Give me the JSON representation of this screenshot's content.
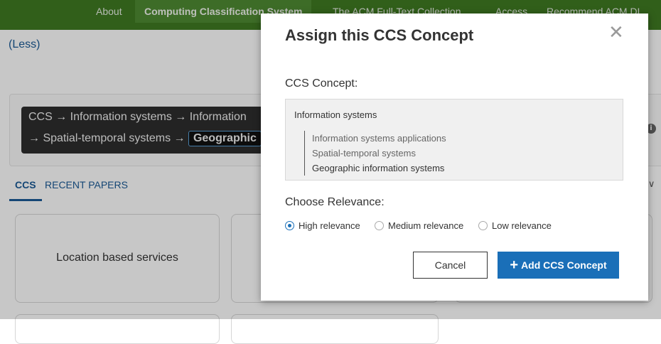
{
  "nav": {
    "items": [
      {
        "label": "About",
        "active": false
      },
      {
        "label": "Computing Classification System",
        "active": true
      },
      {
        "label": "The ACM Full-Text Collection",
        "active": false
      },
      {
        "label": "Access",
        "active": false
      },
      {
        "label": "Recommend ACM DL",
        "active": false
      }
    ]
  },
  "less_link": "(Less)",
  "breadcrumb": {
    "line1": "CCS → Information systems → Information",
    "line2_prefix": "→ Spatial-temporal systems → ",
    "current": "Geographic"
  },
  "tabs": [
    {
      "label": "CCS",
      "active": true
    },
    {
      "label": "RECENT PAPERS",
      "active": false
    }
  ],
  "right_fragment": "y ∨",
  "cards": [
    {
      "label": "Location based services"
    }
  ],
  "modal": {
    "title": "Assign this CCS Concept",
    "concept_label": "CCS Concept:",
    "concept_root": "Information systems",
    "concept_path": [
      "Information systems applications",
      "Spatial-temporal systems",
      "Geographic information systems"
    ],
    "relevance_label": "Choose Relevance:",
    "relevance_options": [
      {
        "label": "High relevance",
        "selected": true
      },
      {
        "label": "Medium relevance",
        "selected": false
      },
      {
        "label": "Low relevance",
        "selected": false
      }
    ],
    "cancel_label": "Cancel",
    "add_label": "Add CCS Concept",
    "accent_color": "#1a6fb8"
  },
  "colors": {
    "nav_background": "#3f7a22",
    "link": "#1a5a96"
  }
}
